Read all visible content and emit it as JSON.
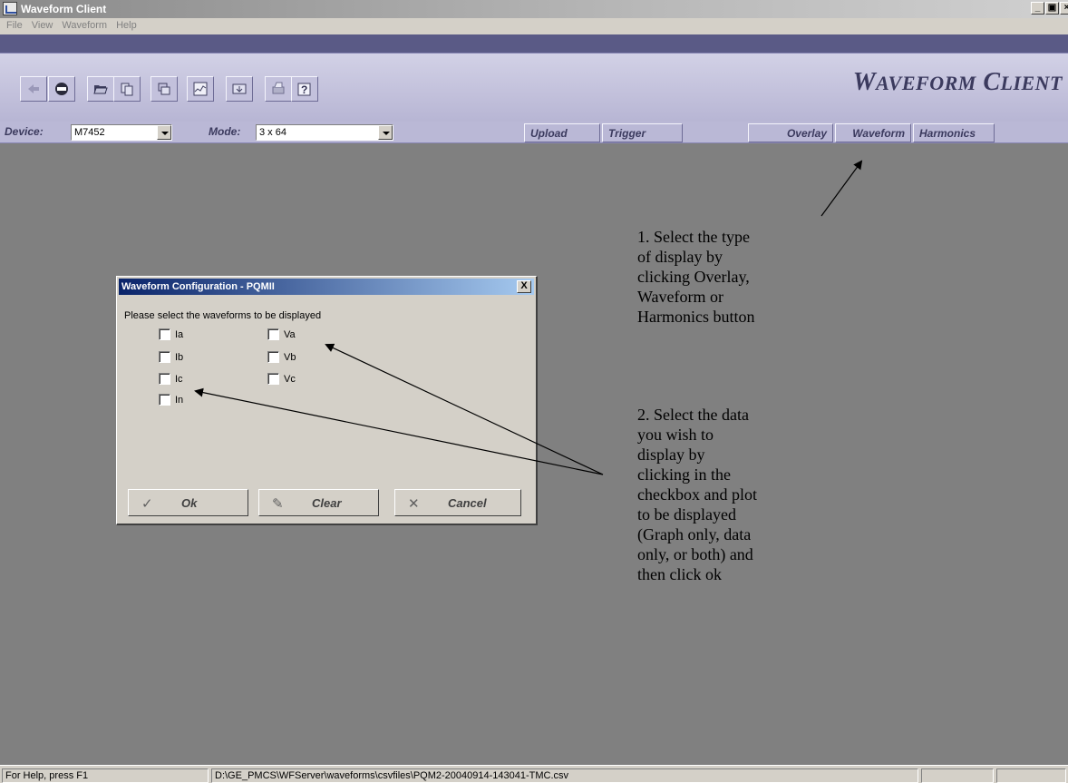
{
  "window": {
    "title": "Waveform Client"
  },
  "menu": {
    "items": [
      "File",
      "View",
      "Waveform",
      "Help"
    ]
  },
  "brand": {
    "first": "W",
    "first_rest": "AVEFORM",
    "second": "C",
    "second_rest": "LIENT"
  },
  "toolbar": {
    "icons": [
      "connect-icon",
      "stop-icon",
      "open-folder-icon",
      "copy-icon",
      "window-icon",
      "chart-icon",
      "export-icon",
      "print-icon",
      "help-icon"
    ]
  },
  "devbar": {
    "device_label": "Device:",
    "device_value": "M7452",
    "mode_label": "Mode:",
    "mode_value": "3 x 64",
    "buttons": {
      "upload": "Upload",
      "trigger": "Trigger",
      "overlay": "Overlay",
      "waveform": "Waveform",
      "harmonics": "Harmonics"
    }
  },
  "dialog": {
    "title": "Waveform Configuration - PQMII",
    "close": "X",
    "prompt": "Please select the waveforms to be displayed",
    "checkboxes": {
      "ia": "Ia",
      "ib": "Ib",
      "ic": "Ic",
      "in": "In",
      "va": "Va",
      "vb": "Vb",
      "vc": "Vc"
    },
    "buttons": {
      "ok": "Ok",
      "clear": "Clear",
      "cancel": "Cancel"
    }
  },
  "annotations": {
    "note1": [
      "1. Select  the type",
      "of display by",
      "clicking Overlay,",
      "Waveform or",
      "Harmonics button"
    ],
    "note2": [
      "2. Select  the data",
      "you wish to",
      "display  by",
      "clicking in the",
      "checkbox and plot",
      "to be displayed",
      "(Graph only, data",
      "only, or both) and",
      "then click ok"
    ]
  },
  "status": {
    "help": "For Help, press F1",
    "path": "D:\\GE_PMCS\\WFServer\\waveforms\\csvfiles\\PQM2-20040914-143041-TMC.csv"
  }
}
